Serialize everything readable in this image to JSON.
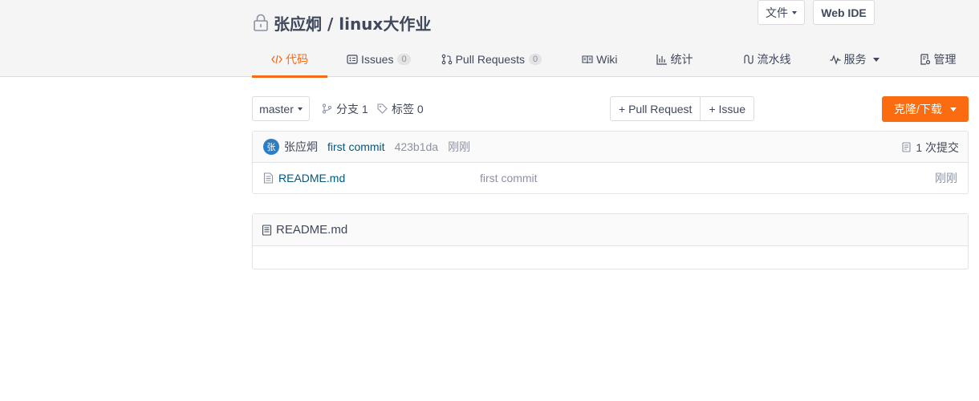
{
  "repo": {
    "title": "张应炯 / linux大作业"
  },
  "tabs": [
    {
      "label": "代码",
      "icon": "code-icon"
    },
    {
      "label": "Issues",
      "count": "0",
      "icon": "issues-icon"
    },
    {
      "label": "Pull Requests",
      "count": "0",
      "icon": "pull-request-icon"
    },
    {
      "label": "Wiki",
      "icon": "wiki-icon"
    },
    {
      "label": "统计",
      "icon": "stats-icon"
    },
    {
      "label": "流水线",
      "icon": "pipeline-icon"
    },
    {
      "label": "服务",
      "icon": "service-icon"
    },
    {
      "label": "管理",
      "icon": "manage-icon"
    }
  ],
  "toolbar": {
    "branch": "master",
    "branches_label": "分支 1",
    "tags_label": "标签 0",
    "new_pr": "+ Pull Request",
    "new_issue": "+ Issue",
    "file_menu": "文件",
    "web_ide": "Web IDE",
    "clone": "克隆/下载"
  },
  "commit": {
    "avatar_letter": "张",
    "author": "张应炯",
    "message": "first commit",
    "sha": "423b1da",
    "time": "刚刚",
    "count": "1 次提交"
  },
  "files": [
    {
      "name": "README.md",
      "commit": "first commit",
      "time": "刚刚"
    }
  ],
  "readme": {
    "title": "README.md"
  },
  "colors": {
    "accent": "#fa6c0f",
    "link": "#005980",
    "text": "#40485b",
    "muted": "#8c92a4"
  }
}
